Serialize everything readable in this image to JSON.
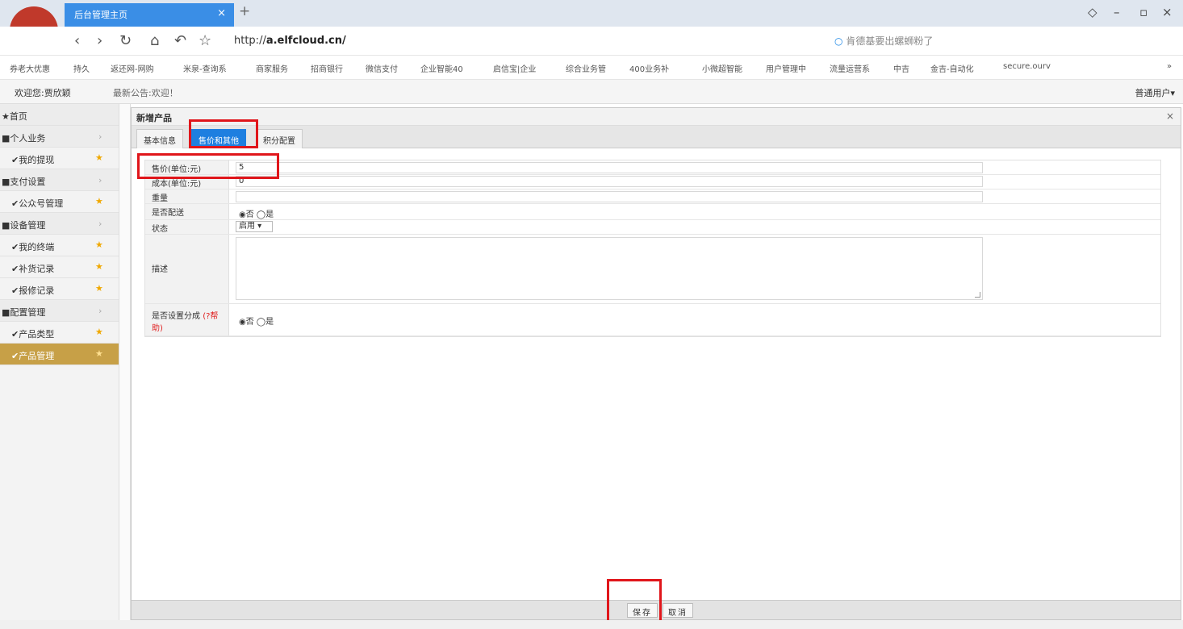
{
  "browser": {
    "tab_title": "后台管理主页",
    "tab_close": "×",
    "new_tab": "+",
    "url_prefix": "http://",
    "url_host": "a.elfcloud.cn/",
    "search_text": "肯德基要出螺蛳粉了",
    "bookmarks": [
      "券老大优惠",
      "持久",
      "返还网-网购",
      "米泉-查询系",
      "商家服务",
      "招商银行",
      "微信支付",
      "企业智能40",
      "启信宝|企业",
      "综合业务管",
      "400业务补",
      "小微超智能",
      "用户管理中",
      "流量运营系",
      "中吉",
      "金吉-自动化",
      "secure.ourv"
    ],
    "more": "»"
  },
  "header": {
    "welcome": "欢迎您:贾欣颖",
    "notice": "最新公告:欢迎！",
    "user": "普通用户▾"
  },
  "sidebar": [
    {
      "label": "★首页",
      "kind": "home"
    },
    {
      "label": "■个人业务",
      "kind": "group"
    },
    {
      "label": "✔我的提现",
      "kind": "item"
    },
    {
      "label": "■支付设置",
      "kind": "group"
    },
    {
      "label": "✔公众号管理",
      "kind": "item"
    },
    {
      "label": "■设备管理",
      "kind": "group"
    },
    {
      "label": "✔我的终端",
      "kind": "item"
    },
    {
      "label": "✔补货记录",
      "kind": "item"
    },
    {
      "label": "✔报修记录",
      "kind": "item"
    },
    {
      "label": "■配置管理",
      "kind": "group"
    },
    {
      "label": "✔产品类型",
      "kind": "item"
    },
    {
      "label": "✔产品管理",
      "kind": "active"
    }
  ],
  "dialog": {
    "title": "新增产品",
    "close": "×",
    "tabs": [
      "基本信息",
      "售价和其他",
      "积分配置"
    ],
    "selected_tab": 1,
    "fields": {
      "price_label": "售价(单位:元)",
      "price_value": "5",
      "cost_label": "成本(单位:元)",
      "cost_value": "0",
      "weight_label": "重量",
      "weight_value": "",
      "delivery_label": "是否配送",
      "delivery_options": "◉否 ◯是",
      "status_label": "状态",
      "status_value": "启用 ▾",
      "desc_label": "描述",
      "split_label": "是否设置分成",
      "split_help": "(?帮助)",
      "split_options": "◉否 ◯是"
    },
    "save": "保存",
    "cancel": "取消"
  }
}
